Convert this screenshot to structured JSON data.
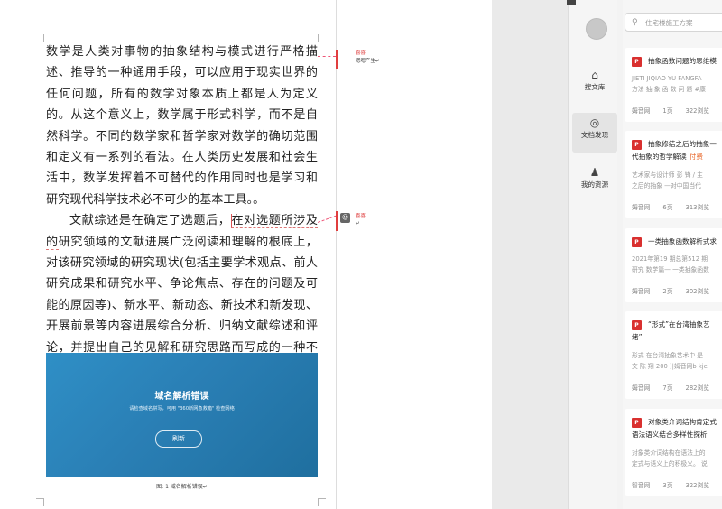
{
  "document": {
    "paragraph1": "数学是人类对事物的抽象结构与模式进行严格描述、推导的一种通用手段，可以应用于现实世界的任何问题，所有的数学对象本质上都是人为定义的。从这个意义上，数学属于形式科学，而不是自然科学。不同的数学家和哲学家对数学的确切范围和定义有一系列的看法。在人类历史发展和社会生活中，数学发挥着不可替代的作用同时也是学习和研究现代科学技术必不可少的基本工具。。",
    "paragraph2_before": "文献综述是在确定了选题后，",
    "paragraph2_selected": "在对选题所涉及的",
    "paragraph2_after": "研究领域的文献进展广泛阅读和理解的根底上，对该研究领域的研究现状(包括主要学术观点、前人研究成果和研究水平、争论焦点、存在的问题及可能的原因等)、新水平、新动态、新技术和新发现、开展前景等内容进展综合分析、归纳文献综述和评论，并提出自己的见解和研究思路而写成的一种不同于的文体。",
    "figure_title": "域名解析错误",
    "figure_subtitle": "请检查域名拼写，可用 \"360断网急救箱\" 检查网络",
    "figure_button": "刷新",
    "figure_caption": "图: 1 域名解析错误↵"
  },
  "comments": [
    {
      "author": "喜喜",
      "text": "嗯嗯产生↵"
    },
    {
      "author": "喜喜",
      "text": "↵"
    }
  ],
  "sidebar": {
    "nav": [
      {
        "label": "搜文库",
        "icon": "home-icon"
      },
      {
        "label": "文档发现",
        "icon": "compass-icon"
      },
      {
        "label": "我的资源",
        "icon": "user-icon"
      }
    ],
    "search_placeholder": "住宅楼施工方案",
    "results": [
      {
        "title": "抽象函数问题的思维模",
        "badge": "",
        "desc": [
          "JIETI JIQIAO YU FANGFA",
          "方法 抽 象 函 数 问 题 #康"
        ],
        "source": "姆音网",
        "pages": "1页",
        "views": "322浏览"
      },
      {
        "title": "抽象修结之后的抽象—",
        "title2": "代抽象的哲学解读",
        "badge": "付费",
        "desc": [
          "艺术家与设计师 彭 锋 / 主",
          "之后的抽象 —对中国当代"
        ],
        "source": "姆音网",
        "pages": "6页",
        "views": "313浏览"
      },
      {
        "title": "一类抽象函数解析式求",
        "badge": "",
        "desc": [
          "2021年第19 期总第512 期",
          "研究 数学篇— 一类抽象函数"
        ],
        "source": "姆音网",
        "pages": "2页",
        "views": "302浏览"
      },
      {
        "title": "“形式”在台湾抽象艺",
        "title2": "绪”",
        "badge": "",
        "desc": [
          "形式 在台湾抽象艺术中 是",
          "文 陈 翔 200 )|姆音网b kje"
        ],
        "source": "姆音网",
        "pages": "7页",
        "views": "282浏览"
      },
      {
        "title": "对象类介词结构肯定式",
        "title2": "语法语义结合多样性探析",
        "badge": "",
        "desc": [
          "对象类介词结构在语法上的",
          "定式与语义上的积极义。 说"
        ],
        "source": "智音网",
        "pages": "3页",
        "views": "322浏览"
      }
    ]
  },
  "colors": {
    "accent": "#d9302f",
    "badge": "#e8672a",
    "figure": "#2a7fb5"
  }
}
